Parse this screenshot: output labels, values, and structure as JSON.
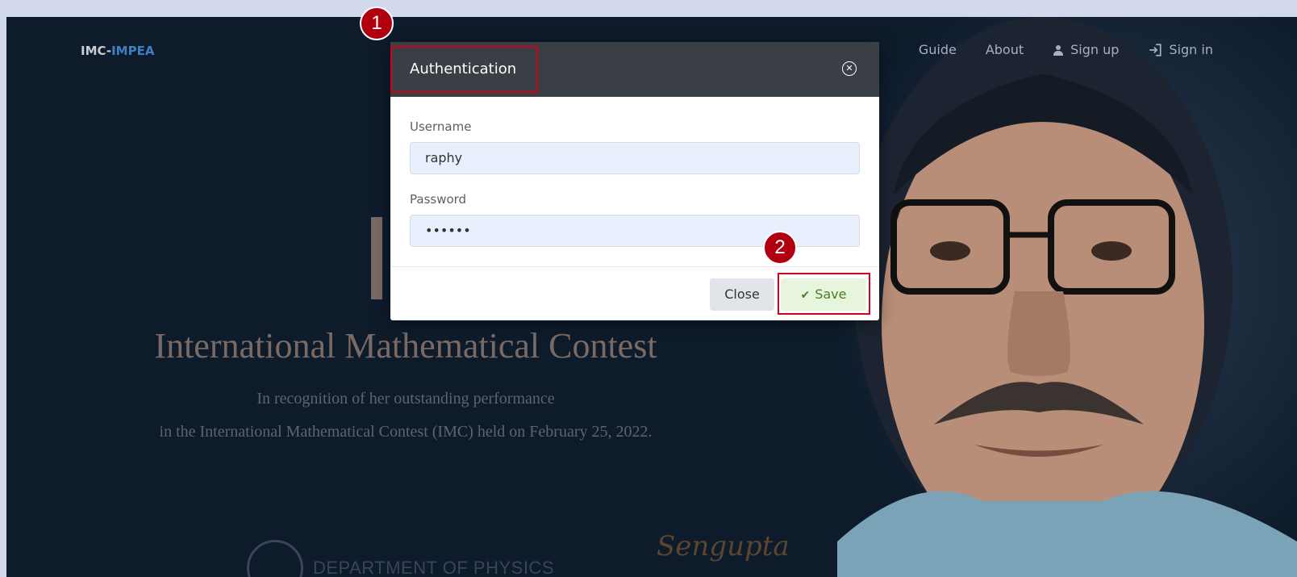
{
  "brand": {
    "prefix": "IMC-",
    "accent": "IMPEA"
  },
  "nav": {
    "items": [
      {
        "label": "Guide"
      },
      {
        "label": "About"
      },
      {
        "label": "Sign up",
        "icon": "user-icon"
      },
      {
        "label": "Sign in",
        "icon": "sign-in-icon"
      }
    ]
  },
  "certificate": {
    "title": "International Mathematical Contest",
    "line1": "In recognition of her outstanding performance",
    "line2": "in the International Mathematical Contest (IMC) held on February 25, 2022.",
    "department": "DEPARTMENT OF PHYSICS",
    "signature": "Sengupta"
  },
  "modal": {
    "title": "Authentication",
    "username_label": "Username",
    "username_value": "raphy",
    "password_label": "Password",
    "password_value": "••••••",
    "close_label": "Close",
    "save_label": "Save"
  },
  "annotations": {
    "marker1": "1",
    "marker2": "2"
  },
  "colors": {
    "highlight": "#d0021b",
    "marker": "#b0000f",
    "accent": "#3f7fc2",
    "save_text": "#4a7d24"
  }
}
